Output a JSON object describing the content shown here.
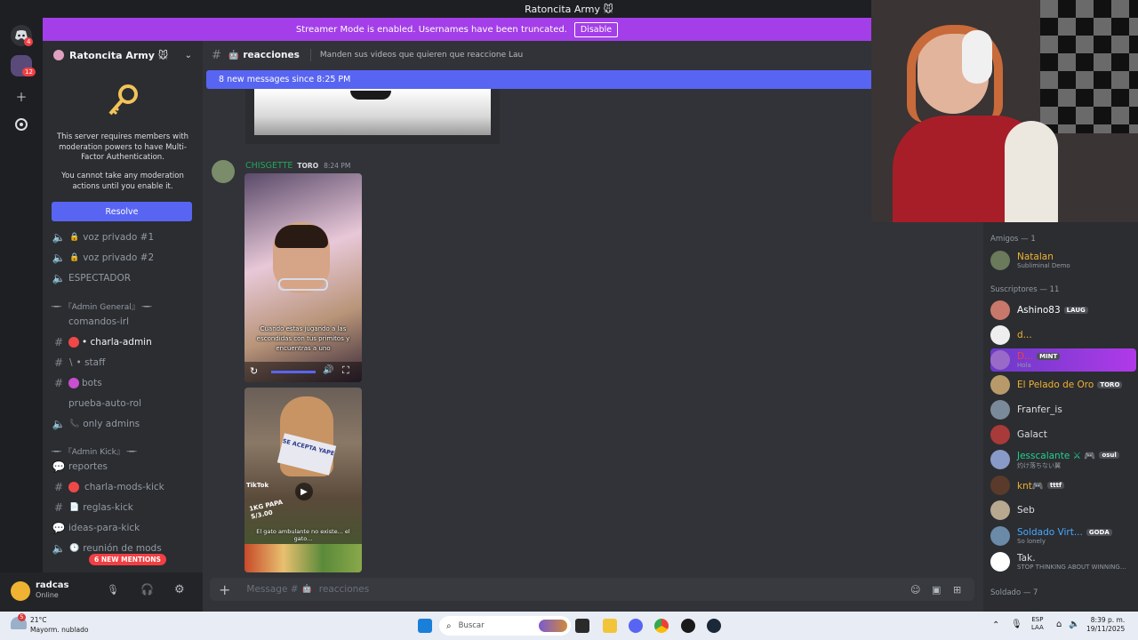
{
  "window": {
    "title": "Ratoncita Army 🐭"
  },
  "rail": {
    "badge_top": "4",
    "badge_server": "12"
  },
  "banner": {
    "text": "Streamer Mode is enabled. Usernames have been truncated.",
    "button": "Disable"
  },
  "server": {
    "name": "Ratoncita Army 🐭",
    "mfa_text_1": "This server requires members with moderation powers to have Multi-Factor Authentication.",
    "mfa_text_2": "You cannot take any moderation actions until you enable it.",
    "resolve": "Resolve"
  },
  "channels": {
    "voz1": "voz privado #1",
    "voz2": "voz privado #2",
    "espectador": "ESPECTADOR",
    "cat_admin_general": "╼╾ 『Admin General』 ╼╾",
    "comandos": "comandos-irl",
    "charla_admin": "• charla-admin",
    "staff": "• staff",
    "bots": "bots",
    "prueba": "prueba-auto-rol",
    "only_admins": "only admins",
    "cat_admin_kick": "╼╾ 『Admin Kick』 ╼╾",
    "reportes": "reportes",
    "charla_mods_kick": "charla-mods-kick",
    "reglas_kick": "reglas-kick",
    "ideas_kick": "ideas-para-kick",
    "reunion": "reunión de mods",
    "new_mentions": "6 NEW MENTIONS"
  },
  "user": {
    "name": "radcas",
    "status": "Online"
  },
  "chat": {
    "channel": "reacciones",
    "topic": "Manden sus videos que quieren que reaccione Lau",
    "new_messages": "8 new messages since 8:25 PM",
    "author": "CHISGETTE",
    "author_tag": "TORO",
    "time": "8:24 PM",
    "video_caption": "Cuando estas jugando a las escondidas con tus primitos y encuentras a uno",
    "video2_caption": "El gato ambulante no existe... el gato...",
    "video2_sign": "SE ACEPTA YAPE",
    "video2_price": "1KG PAPA S/3.00",
    "tiktok": "TikTok",
    "composer_placeholder": "Message #",
    "composer_channel": "reacciones"
  },
  "members": {
    "cat_amigos": "Amigos — 1",
    "cat_subs": "Suscriptores — 11",
    "cat_soldado": "Soldado — 7",
    "list": [
      {
        "name": "Natalan",
        "sub": "Subliminal Demo",
        "tag": "",
        "color": "#f0b232"
      },
      {
        "name": "Ashino83",
        "sub": "",
        "tag": "LAUG",
        "color": "#ffffff"
      },
      {
        "name": "d...",
        "sub": "",
        "tag": "",
        "color": "#f0b232"
      },
      {
        "name": "D...",
        "sub": "Hola",
        "tag": "MINT",
        "color": "#f23f43"
      },
      {
        "name": "El Pelado de Oro",
        "sub": "",
        "tag": "TORO",
        "color": "#f0b232"
      },
      {
        "name": "Franfer_is",
        "sub": "",
        "tag": "",
        "color": "#dbdee1"
      },
      {
        "name": "Galact",
        "sub": "",
        "tag": "",
        "color": "#dbdee1"
      },
      {
        "name": "Jesscalante ⚔ 🎮",
        "sub": "灼け落ちない翼",
        "tag": "osul",
        "color": "#23d18b"
      },
      {
        "name": "knt🎮",
        "sub": "",
        "tag": "tttf",
        "color": "#f0b232"
      },
      {
        "name": "Seb",
        "sub": "",
        "tag": "",
        "color": "#dbdee1"
      },
      {
        "name": "Soldado Virt...",
        "sub": "So lonely",
        "tag": "GODA",
        "color": "#4aa8ff"
      },
      {
        "name": "Tak.",
        "sub": "STOP THINKING ABOUT WINNING...",
        "tag": "",
        "color": "#dbdee1"
      }
    ]
  },
  "taskbar": {
    "temp": "21°C",
    "weather": "Mayorm. nublado",
    "search": "Buscar",
    "lang1": "ESP",
    "lang2": "LAA",
    "time": "8:39 p. m.",
    "date": "19/11/2025",
    "notif": "5"
  }
}
